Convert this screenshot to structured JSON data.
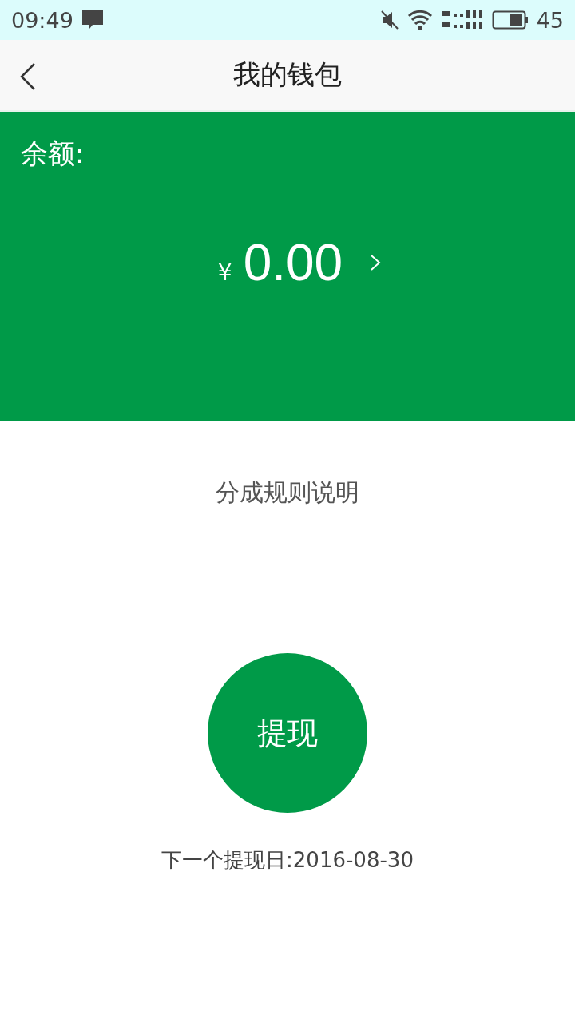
{
  "status_bar": {
    "time": "09:49",
    "battery": "45"
  },
  "header": {
    "title": "我的钱包"
  },
  "balance": {
    "label": "余额:",
    "currency": "¥",
    "amount": "0.00"
  },
  "rules": {
    "label": "分成规则说明"
  },
  "withdraw": {
    "label": "提现",
    "next_date": "下一个提现日:2016-08-30"
  }
}
